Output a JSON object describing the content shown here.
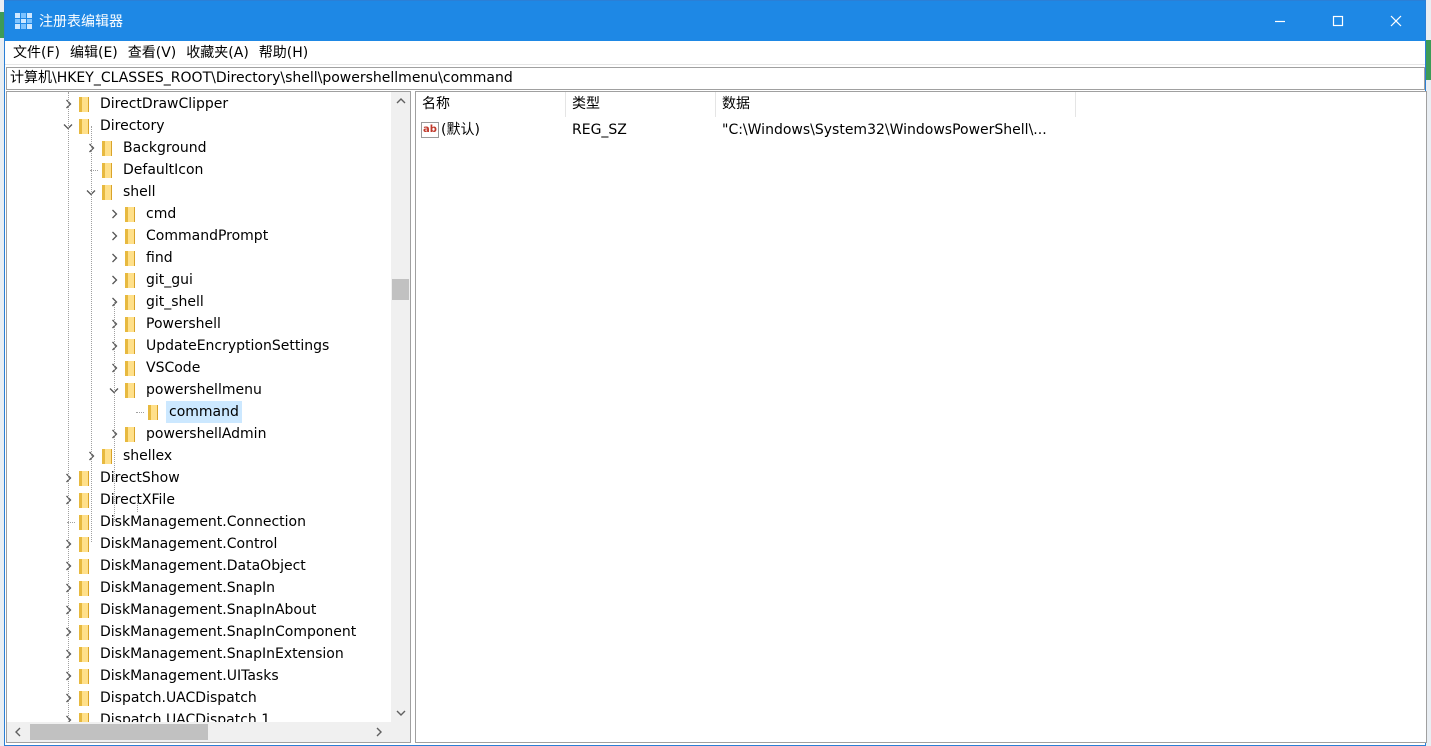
{
  "window": {
    "title": "注册表编辑器",
    "controls": {
      "minimize": "minimize-icon",
      "maximize": "maximize-icon",
      "close": "close-icon"
    }
  },
  "menu": [
    "文件(F)",
    "编辑(E)",
    "查看(V)",
    "收藏夹(A)",
    "帮助(H)"
  ],
  "address": "计算机\\HKEY_CLASSES_ROOT\\Directory\\shell\\powershellmenu\\command",
  "tree": [
    {
      "label": "DirectDrawClipper",
      "level": 0,
      "expander": "collapsed"
    },
    {
      "label": "Directory",
      "level": 0,
      "expander": "expanded"
    },
    {
      "label": "Background",
      "level": 1,
      "expander": "collapsed"
    },
    {
      "label": "DefaultIcon",
      "level": 1,
      "expander": "none"
    },
    {
      "label": "shell",
      "level": 1,
      "expander": "expanded"
    },
    {
      "label": "cmd",
      "level": 2,
      "expander": "collapsed"
    },
    {
      "label": "CommandPrompt",
      "level": 2,
      "expander": "collapsed"
    },
    {
      "label": "find",
      "level": 2,
      "expander": "collapsed"
    },
    {
      "label": "git_gui",
      "level": 2,
      "expander": "collapsed"
    },
    {
      "label": "git_shell",
      "level": 2,
      "expander": "collapsed"
    },
    {
      "label": "Powershell",
      "level": 2,
      "expander": "collapsed"
    },
    {
      "label": "UpdateEncryptionSettings",
      "level": 2,
      "expander": "collapsed"
    },
    {
      "label": "VSCode",
      "level": 2,
      "expander": "collapsed"
    },
    {
      "label": "powershellmenu",
      "level": 2,
      "expander": "expanded"
    },
    {
      "label": "command",
      "level": 3,
      "expander": "none",
      "selected": true
    },
    {
      "label": "powershellAdmin",
      "level": 2,
      "expander": "collapsed"
    },
    {
      "label": "shellex",
      "level": 1,
      "expander": "collapsed"
    },
    {
      "label": "DirectShow",
      "level": 0,
      "expander": "collapsed"
    },
    {
      "label": "DirectXFile",
      "level": 0,
      "expander": "collapsed"
    },
    {
      "label": "DiskManagement.Connection",
      "level": 0,
      "expander": "none"
    },
    {
      "label": "DiskManagement.Control",
      "level": 0,
      "expander": "collapsed"
    },
    {
      "label": "DiskManagement.DataObject",
      "level": 0,
      "expander": "collapsed"
    },
    {
      "label": "DiskManagement.SnapIn",
      "level": 0,
      "expander": "collapsed"
    },
    {
      "label": "DiskManagement.SnapInAbout",
      "level": 0,
      "expander": "collapsed"
    },
    {
      "label": "DiskManagement.SnapInComponent",
      "level": 0,
      "expander": "collapsed"
    },
    {
      "label": "DiskManagement.SnapInExtension",
      "level": 0,
      "expander": "collapsed"
    },
    {
      "label": "DiskManagement.UITasks",
      "level": 0,
      "expander": "collapsed"
    },
    {
      "label": "Dispatch.UACDispatch",
      "level": 0,
      "expander": "collapsed"
    },
    {
      "label": "Dispatch.UACDispatch.1",
      "level": 0,
      "expander": "collapsed"
    }
  ],
  "list": {
    "columns": [
      "名称",
      "类型",
      "数据"
    ],
    "rows": [
      {
        "icon": "string-value-icon",
        "icon_text": "ab",
        "name": "(默认)",
        "type": "REG_SZ",
        "data": "\"C:\\Windows\\System32\\WindowsPowerShell\\..."
      }
    ]
  },
  "colors": {
    "titlebar": "#1e88e5",
    "selection": "#cce8ff",
    "folder": "#ffe08a"
  }
}
